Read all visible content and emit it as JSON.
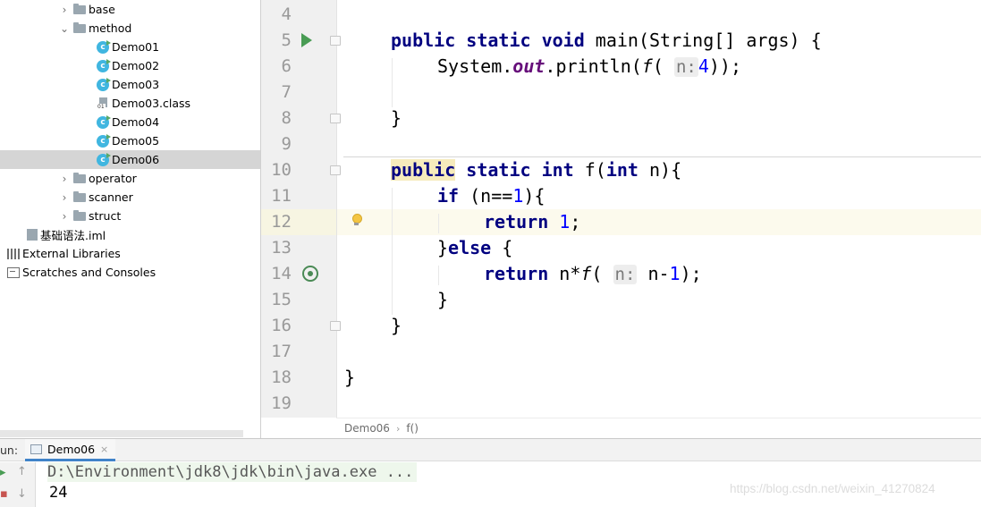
{
  "project_tree": {
    "items": [
      {
        "label": "base",
        "type": "folder",
        "expanded": false
      },
      {
        "label": "method",
        "type": "folder",
        "expanded": true
      },
      {
        "label": "Demo01",
        "type": "class"
      },
      {
        "label": "Demo02",
        "type": "class"
      },
      {
        "label": "Demo03",
        "type": "class"
      },
      {
        "label": "Demo03.class",
        "type": "classfile"
      },
      {
        "label": "Demo04",
        "type": "class"
      },
      {
        "label": "Demo05",
        "type": "class"
      },
      {
        "label": "Demo06",
        "type": "class",
        "selected": true
      },
      {
        "label": "operator",
        "type": "folder",
        "expanded": false
      },
      {
        "label": "scanner",
        "type": "folder",
        "expanded": false
      },
      {
        "label": "struct",
        "type": "folder",
        "expanded": false
      },
      {
        "label": "基础语法.iml",
        "type": "iml"
      },
      {
        "label": "External Libraries",
        "type": "library"
      },
      {
        "label": "Scratches and Consoles",
        "type": "scratches"
      }
    ]
  },
  "editor": {
    "line_numbers": [
      "4",
      "5",
      "6",
      "7",
      "8",
      "9",
      "10",
      "11",
      "12",
      "13",
      "14",
      "15",
      "16",
      "17",
      "18",
      "19"
    ],
    "current_line": "12",
    "code": {
      "l5": {
        "kw1": "public",
        "kw2": "static",
        "kw3": "void",
        "rest": " main(String[] args) {"
      },
      "l6": {
        "a": "System.",
        "field": "out",
        "b": ".println(",
        "fn": "f",
        "c": "(",
        "hint": "n:",
        "num": "4",
        "d": "));"
      },
      "l8": {
        "text": "}"
      },
      "l10": {
        "kw1": "public",
        "kw2": "static",
        "kw3": "int",
        "a": " f(",
        "kw4": "int",
        "b": " n){"
      },
      "l11": {
        "kw": "if",
        "a": " (n==",
        "num": "1",
        "b": "){"
      },
      "l12": {
        "kw": "return",
        "num": "1",
        "b": ";"
      },
      "l13": {
        "a": "}",
        "kw": "else",
        "b": " {"
      },
      "l14": {
        "kw": "return",
        "a": " n*",
        "fn": "f",
        "b": "(",
        "hint": "n:",
        "c": " n-",
        "num": "1",
        "d": ");"
      },
      "l15": {
        "text": "}"
      },
      "l16": {
        "text": "}"
      },
      "l18": {
        "text": "}"
      }
    },
    "breadcrumb": [
      "Demo06",
      "f()"
    ]
  },
  "run_panel": {
    "label": "un:",
    "tab_label": "Demo06",
    "tab_close": "×",
    "command": "D:\\Environment\\jdk8\\jdk\\bin\\java.exe ...",
    "output": "24"
  },
  "watermark": "https://blog.csdn.net/weixin_41270824"
}
